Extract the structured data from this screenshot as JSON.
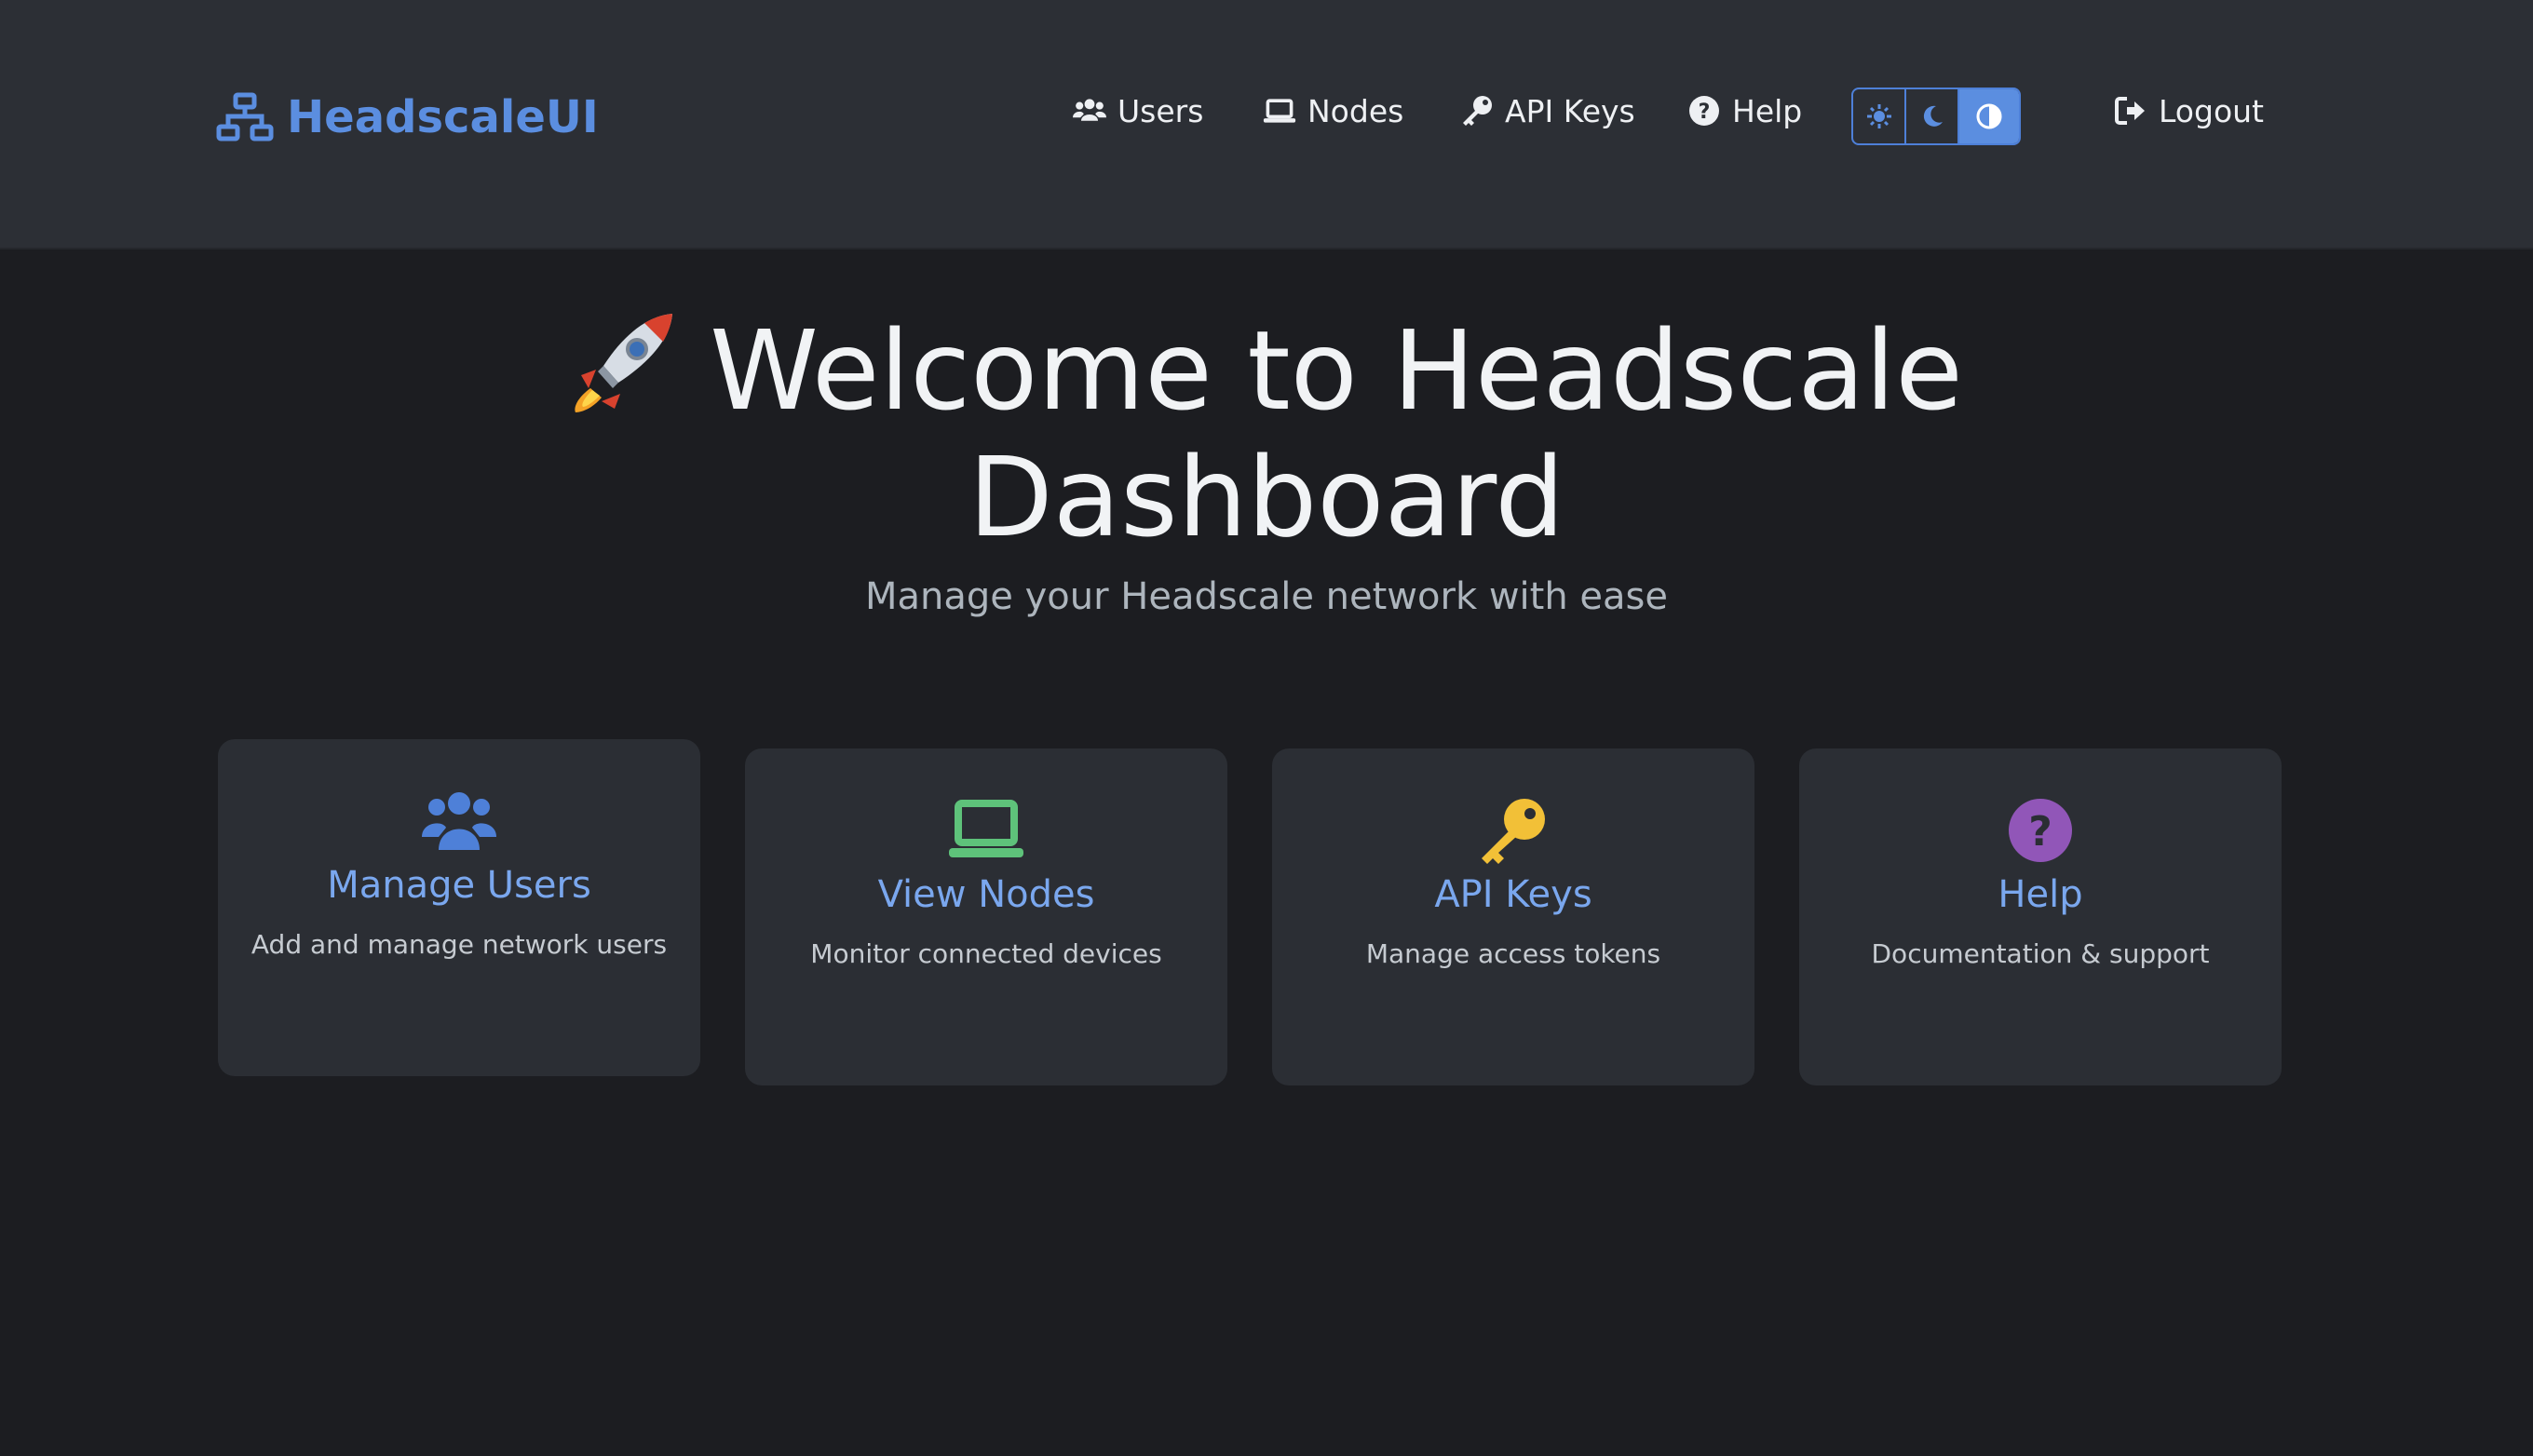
{
  "brand": {
    "name": "HeadscaleUI",
    "icon": "network-icon",
    "color": "#5b8ee0"
  },
  "nav": {
    "users": {
      "label": "Users",
      "icon": "users-icon"
    },
    "nodes": {
      "label": "Nodes",
      "icon": "laptop-icon"
    },
    "api_keys": {
      "label": "API Keys",
      "icon": "key-icon"
    },
    "help": {
      "label": "Help",
      "icon": "question-circle-icon"
    },
    "logout": {
      "label": "Logout",
      "icon": "logout-icon"
    },
    "theme_toggle": {
      "options": [
        "light",
        "dark",
        "auto"
      ],
      "selected": "auto"
    }
  },
  "hero": {
    "emoji": "rocket-icon",
    "title_line1": "Welcome to Headscale",
    "title_line2": "Dashboard",
    "subtitle": "Manage your Headscale network with ease"
  },
  "cards": [
    {
      "title": "Manage Users",
      "description": "Add and manage network users",
      "icon": "users-icon",
      "icon_color": "#4e80d8"
    },
    {
      "title": "View Nodes",
      "description": "Monitor connected devices",
      "icon": "laptop-icon",
      "icon_color": "#5ec27a"
    },
    {
      "title": "API Keys",
      "description": "Manage access tokens",
      "icon": "key-icon",
      "icon_color": "#f2c037"
    },
    {
      "title": "Help",
      "description": "Documentation & support",
      "icon": "question-circle-icon",
      "icon_color": "#9156b8"
    }
  ]
}
